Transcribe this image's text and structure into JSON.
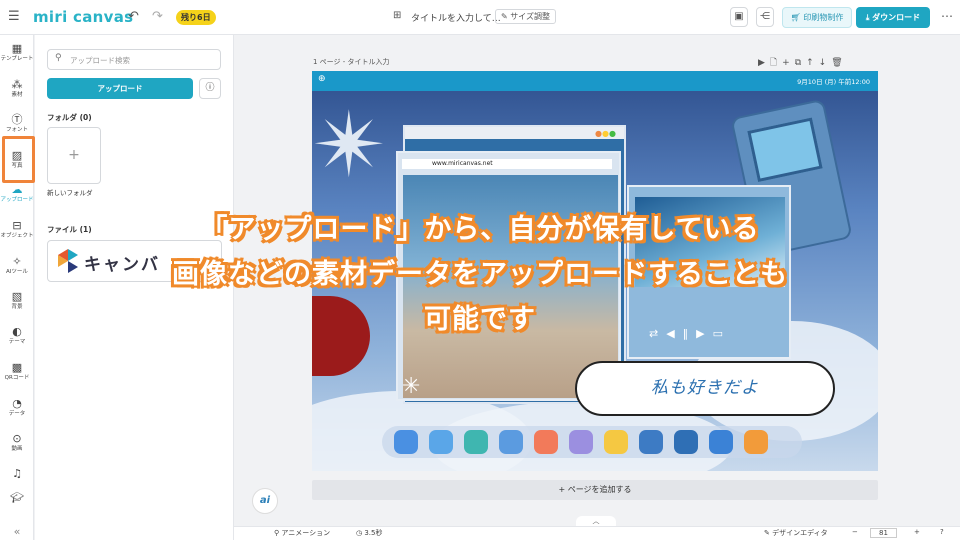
{
  "header": {
    "logo": "miri canvas",
    "trial_badge": "残り6日",
    "doc_title": "タイトルを入力して…",
    "resize_label": "サイズ調整",
    "print_label": "印刷物制作",
    "download_label": "ダウンロード"
  },
  "rail": {
    "items": [
      {
        "label": "テンプレート",
        "icon": "layout-icon"
      },
      {
        "label": "素材",
        "icon": "shapes-icon"
      },
      {
        "label": "フォント",
        "icon": "text-icon"
      },
      {
        "label": "写真",
        "icon": "photo-icon"
      },
      {
        "label": "アップロード",
        "icon": "upload-icon"
      },
      {
        "label": "オブジェクト",
        "icon": "object-icon"
      },
      {
        "label": "AIツール",
        "icon": "sparkle-icon"
      },
      {
        "label": "背景",
        "icon": "pattern-icon"
      },
      {
        "label": "テーマ",
        "icon": "palette-icon"
      },
      {
        "label": "QRコード",
        "icon": "qr-icon"
      },
      {
        "label": "データ",
        "icon": "chart-icon"
      },
      {
        "label": "動画",
        "icon": "video-icon"
      },
      {
        "label": "",
        "icon": "music-icon"
      }
    ]
  },
  "panel": {
    "search_placeholder": "アップロード検索",
    "upload_button": "アップロード",
    "folders_label": "フォルダ (0)",
    "new_folder_label": "新しいフォルダ",
    "files_label": "ファイル (1)",
    "file_thumb_text": "キャンバ"
  },
  "canvas": {
    "page_label": "1 ページ - タイトル入力",
    "status_time": "9月10日 (月) 午前12:00",
    "url_text": "www.miricanvas.net",
    "bubble_text": "私も好きだよ",
    "add_page": "+ ページを追加する"
  },
  "overlay": {
    "line1": "「アップロード」から、自分が保有している",
    "line2": "画像などの素材データをアップロードすることも",
    "line3": "可能です"
  },
  "bottom": {
    "animation": "アニメーション",
    "duration": "3.5秒",
    "design_editor": "デザインエディタ",
    "zoom": "81"
  },
  "colors": {
    "accent": "#1fa6c2",
    "overlay_stroke": "#f08a2b",
    "active_highlight": "#f0843a"
  }
}
